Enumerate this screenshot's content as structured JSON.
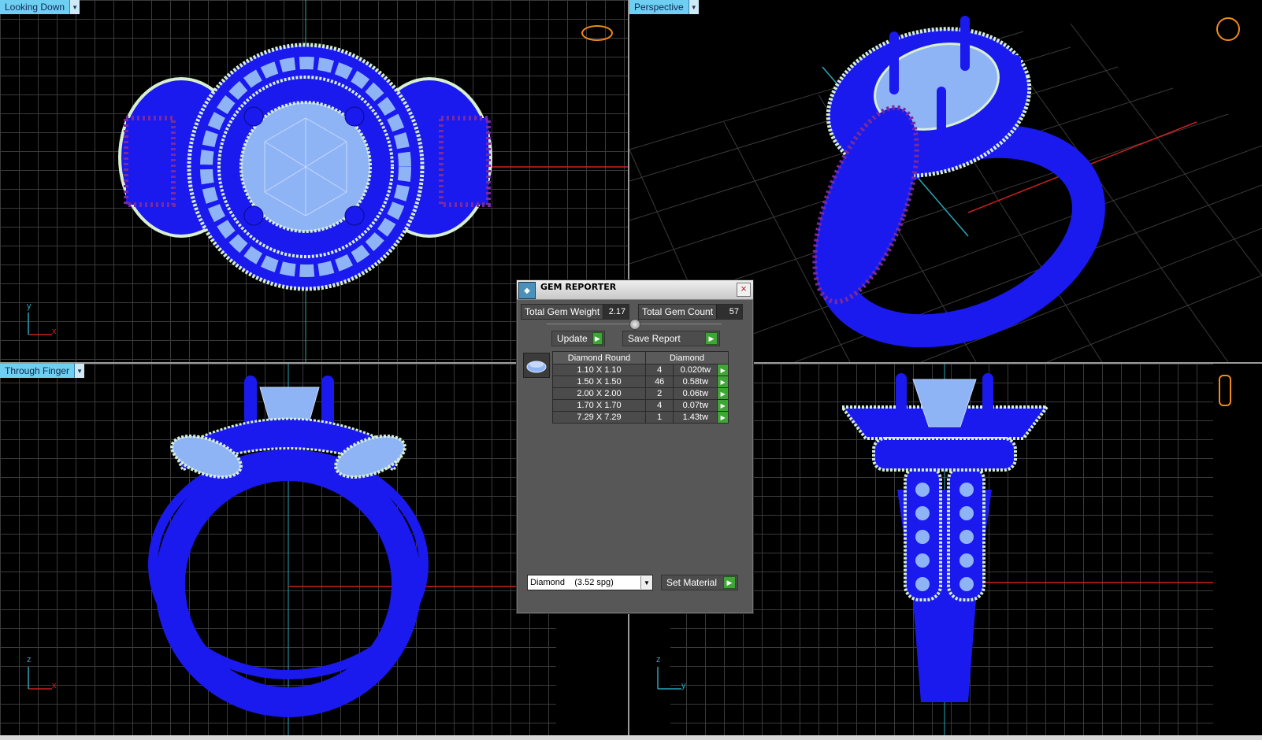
{
  "viewports": {
    "top_left": {
      "label": "Looking Down",
      "axis_h": "x",
      "axis_v": "y"
    },
    "top_right": {
      "label": "Perspective"
    },
    "bottom_left": {
      "label": "Through Finger",
      "axis_h": "x",
      "axis_v": "z"
    },
    "bottom_right": {
      "axis_h": "y",
      "axis_v": "z"
    }
  },
  "gem_reporter": {
    "title": "GEM REPORTER",
    "close_glyph": "×",
    "total_weight_label": "Total Gem Weight",
    "total_weight_value": "2.17",
    "total_count_label": "Total Gem Count",
    "total_count_value": "57",
    "update_label": "Update",
    "save_report_label": "Save Report",
    "table": {
      "headers": [
        "Diamond Round",
        "Diamond"
      ],
      "rows": [
        {
          "size": "1.10 X 1.10",
          "count": "4",
          "weight": "0.020tw"
        },
        {
          "size": "1.50 X 1.50",
          "count": "46",
          "weight": "0.58tw"
        },
        {
          "size": "2.00 X 2.00",
          "count": "2",
          "weight": "0.06tw"
        },
        {
          "size": "1.70 X 1.70",
          "count": "4",
          "weight": "0.07tw"
        },
        {
          "size": "7.29 X 7.29",
          "count": "1",
          "weight": "1.43tw"
        }
      ]
    },
    "material_value": "Diamond    (3.52 spg)",
    "set_material_label": "Set Material"
  },
  "colors": {
    "metal": "#1a1aee",
    "gem": "#8fb4f5",
    "bead": "#d8efd0",
    "accent_bead": "#7a2a9a",
    "grid": "#3a3a3a",
    "axis_red": "#cc2020",
    "axis_cyan": "#2aa6b8",
    "label_bg": "#6ecff2",
    "icon_orange": "#f08a1c"
  },
  "icons": [
    "view-cube-ring-icon",
    "dropdown-arrow-icon",
    "play-arrow-icon",
    "close-icon"
  ]
}
